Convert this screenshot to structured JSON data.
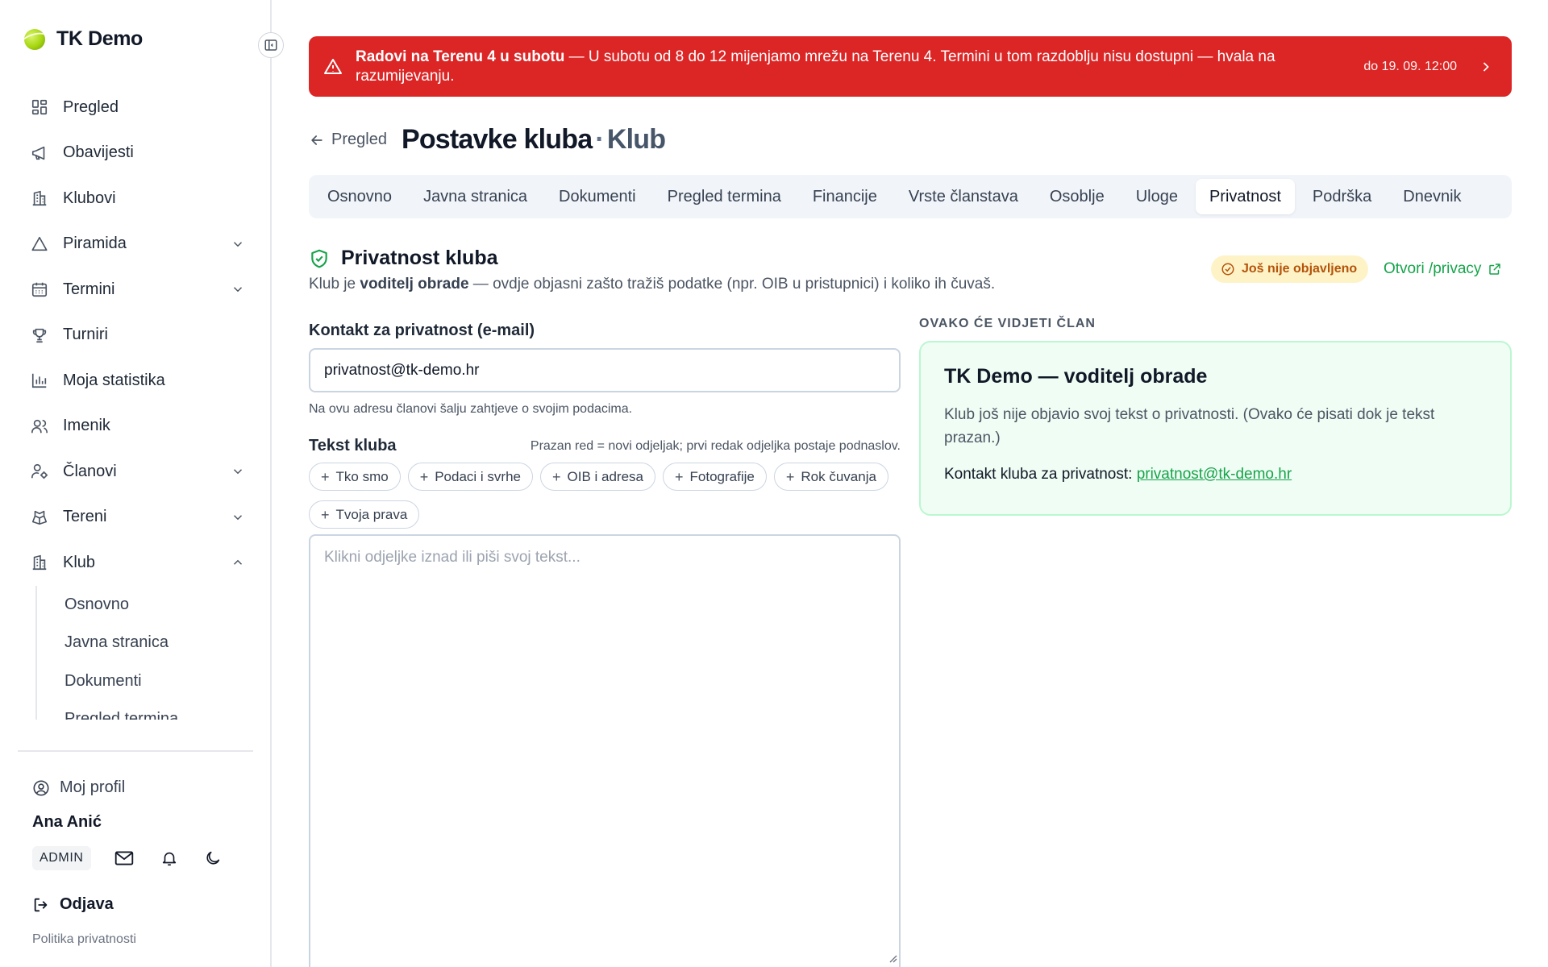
{
  "app": {
    "name": "TK Demo"
  },
  "sidebar": {
    "items": [
      {
        "label": "Pregled",
        "icon": "dashboard-icon",
        "chevron": false
      },
      {
        "label": "Obavijesti",
        "icon": "megaphone-icon",
        "chevron": false
      },
      {
        "label": "Klubovi",
        "icon": "building-icon",
        "chevron": false
      },
      {
        "label": "Piramida",
        "icon": "triangle-icon",
        "chevron": "down"
      },
      {
        "label": "Termini",
        "icon": "calendar-icon",
        "chevron": "down"
      },
      {
        "label": "Turniri",
        "icon": "trophy-icon",
        "chevron": false
      },
      {
        "label": "Moja statistika",
        "icon": "bar-chart-icon",
        "chevron": false
      },
      {
        "label": "Imenik",
        "icon": "users-icon",
        "chevron": false
      },
      {
        "label": "Članovi",
        "icon": "user-cog-icon",
        "chevron": "down"
      },
      {
        "label": "Tereni",
        "icon": "court-icon",
        "chevron": "down"
      },
      {
        "label": "Klub",
        "icon": "building-icon",
        "chevron": "up"
      }
    ],
    "klub_subitems": [
      "Osnovno",
      "Javna stranica",
      "Dokumenti",
      "Pregled termina"
    ],
    "profile_label": "Moj profil",
    "user_name": "Ana Anić",
    "role": "ADMIN",
    "logout_label": "Odjava",
    "privacy_label": "Politika privatnosti"
  },
  "banner": {
    "title": "Radovi na Terenu 4 u subotu",
    "message": " — U subotu od 8 do 12 mijenjamo mrežu na Terenu 4. Termini u tom razdoblju nisu dostupni — hvala na razumijevanju.",
    "until": "do 19. 09. 12:00",
    "color": "#dc2626"
  },
  "header": {
    "back_label": "Pregled",
    "title": "Postavke kluba",
    "separator": "·",
    "subtitle": "Klub"
  },
  "tabs": [
    {
      "label": "Osnovno",
      "active": false
    },
    {
      "label": "Javna stranica",
      "active": false
    },
    {
      "label": "Dokumenti",
      "active": false
    },
    {
      "label": "Pregled termina",
      "active": false
    },
    {
      "label": "Financije",
      "active": false
    },
    {
      "label": "Vrste članstava",
      "active": false
    },
    {
      "label": "Osoblje",
      "active": false
    },
    {
      "label": "Uloge",
      "active": false
    },
    {
      "label": "Privatnost",
      "active": true
    },
    {
      "label": "Podrška",
      "active": false
    },
    {
      "label": "Dnevnik",
      "active": false
    }
  ],
  "section": {
    "title": "Privatnost kluba",
    "desc_pre": "Klub je ",
    "desc_bold": "voditelj obrade",
    "desc_post": " — ovdje objasni zašto tražiš podatke (npr. OIB u pristupnici) i koliko ih čuvaš.",
    "status": "Još nije objavljeno",
    "open_link": "Otvori /privacy"
  },
  "form": {
    "contact_label": "Kontakt za privatnost (e-mail)",
    "contact_value": "privatnost@tk-demo.hr",
    "contact_help": "Na ovu adresu članovi šalju zahtjeve o svojim podacima.",
    "text_label": "Tekst kluba",
    "text_hint": "Prazan red = novi odjeljak; prvi redak odjeljka postaje podnaslov.",
    "chips": [
      "Tko smo",
      "Podaci i svrhe",
      "OIB i adresa",
      "Fotografije",
      "Rok čuvanja",
      "Tvoja prava"
    ],
    "text_placeholder": "Klikni odjeljke iznad ili piši svoj tekst..."
  },
  "preview": {
    "label": "OVAKO ĆE VIDJETI ČLAN",
    "title": "TK Demo — voditelj obrade",
    "body": "Klub još nije objavio svoj tekst o privatnosti. (Ovako će pisati dok je tekst prazan.)",
    "contact_pre": "Kontakt kluba za privatnost: ",
    "contact_email": "privatnost@tk-demo.hr"
  },
  "colors": {
    "accent_green": "#16a34a",
    "danger": "#dc2626",
    "warning_bg": "#fef3c7"
  }
}
